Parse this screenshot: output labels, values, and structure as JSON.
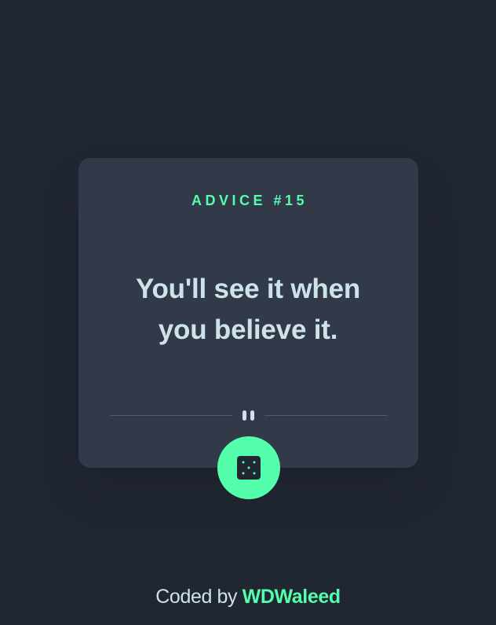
{
  "card": {
    "advice_label": "ADVICE #15",
    "quote_line_1": "You'll see it when",
    "quote_line_2": "you believe it."
  },
  "dice_button": {
    "icon": "dice-icon",
    "title": "Get new advice"
  },
  "footer": {
    "prefix": "Coded by",
    "author": "WDWaleed"
  },
  "colors": {
    "background": "#202632",
    "card": "#323a49",
    "accent": "#53ffaa",
    "text": "#cee3e9",
    "divider": "#4f5d74"
  }
}
